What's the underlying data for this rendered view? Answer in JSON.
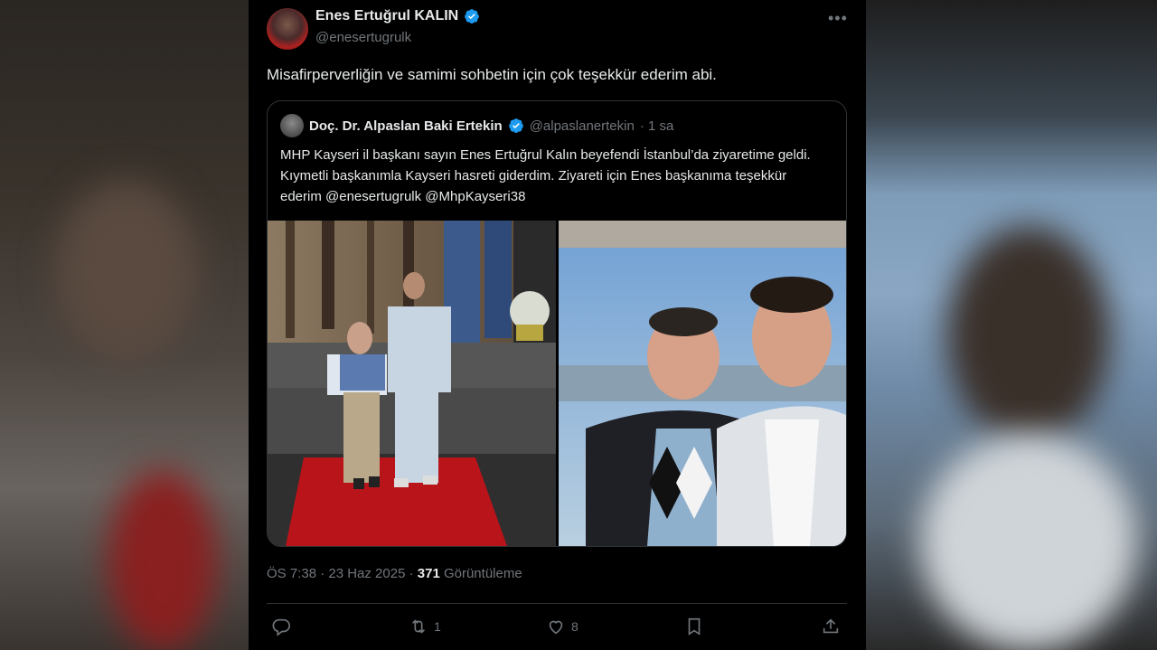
{
  "author": {
    "name": "Enes Ertuğrul KALIN",
    "handle": "@enesertugrulk"
  },
  "tweet_text": "Misafirperverliğin ve samimi sohbetin için çok teşekkür ederim abi.",
  "quoted": {
    "name": "Doç. Dr. Alpaslan Baki Ertekin",
    "handle": "@alpaslanertekin",
    "time": "· 1 sa",
    "text": "MHP Kayseri il başkanı sayın Enes Ertuğrul Kalın beyefendi İstanbul’da ziyaretime geldi. Kıymetli başkanımla Kayseri hasreti giderdim. Ziyareti için Enes başkanıma teşekkür ederim @enesertugrulk @MhpKayseri38"
  },
  "meta": {
    "timestamp": "ÖS 7:38 · 23 Haz 2025 · ",
    "views_count": "371",
    "views_label": " Görüntüleme"
  },
  "actions": {
    "reply_count": "",
    "retweet_count": "1",
    "like_count": "8"
  },
  "colors": {
    "verified_blue": "#1d9bf0",
    "background": "#000000",
    "text_primary": "#e7e9ea",
    "text_secondary": "#71767b",
    "border": "#2f3336"
  },
  "icons": {
    "more": "more-dots-icon",
    "reply": "reply-icon",
    "retweet": "retweet-icon",
    "like": "heart-icon",
    "bookmark": "bookmark-icon",
    "share": "share-icon",
    "verified": "verified-badge-icon"
  }
}
